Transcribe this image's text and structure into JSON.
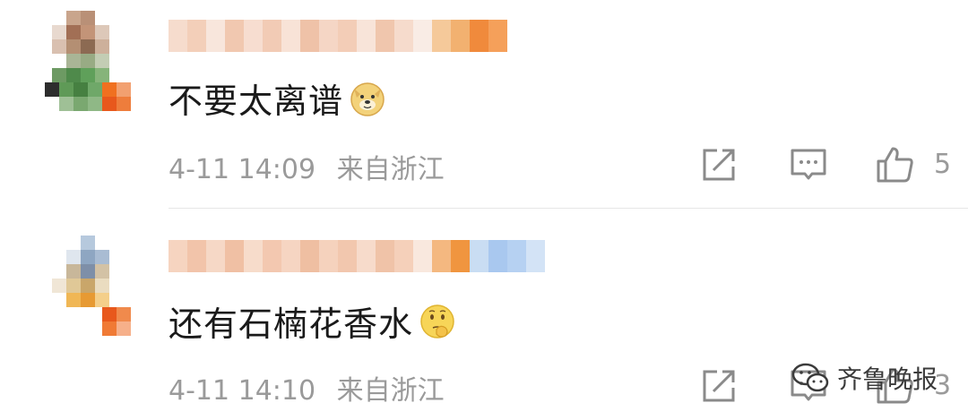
{
  "comments": [
    {
      "text": "不要太离谱",
      "emoji": "doge-emoji",
      "time": "4-11 14:09",
      "location": "来自浙江",
      "like_count": "5"
    },
    {
      "text": "还有石楠花香水",
      "emoji": "thinking-emoji",
      "time": "4-11 14:10",
      "location": "来自浙江",
      "like_count": "3"
    }
  ],
  "watermark": {
    "label": "齐鲁晚报"
  },
  "icons": {
    "share": "share-icon",
    "reply": "comment-icon",
    "like": "thumbs-up-icon",
    "watermark": "wechat-icon"
  },
  "colors": {
    "text": "#1a1a1a",
    "meta": "#9a9a9a",
    "icon": "#8a8a8a",
    "divider": "#e6e6e6"
  }
}
